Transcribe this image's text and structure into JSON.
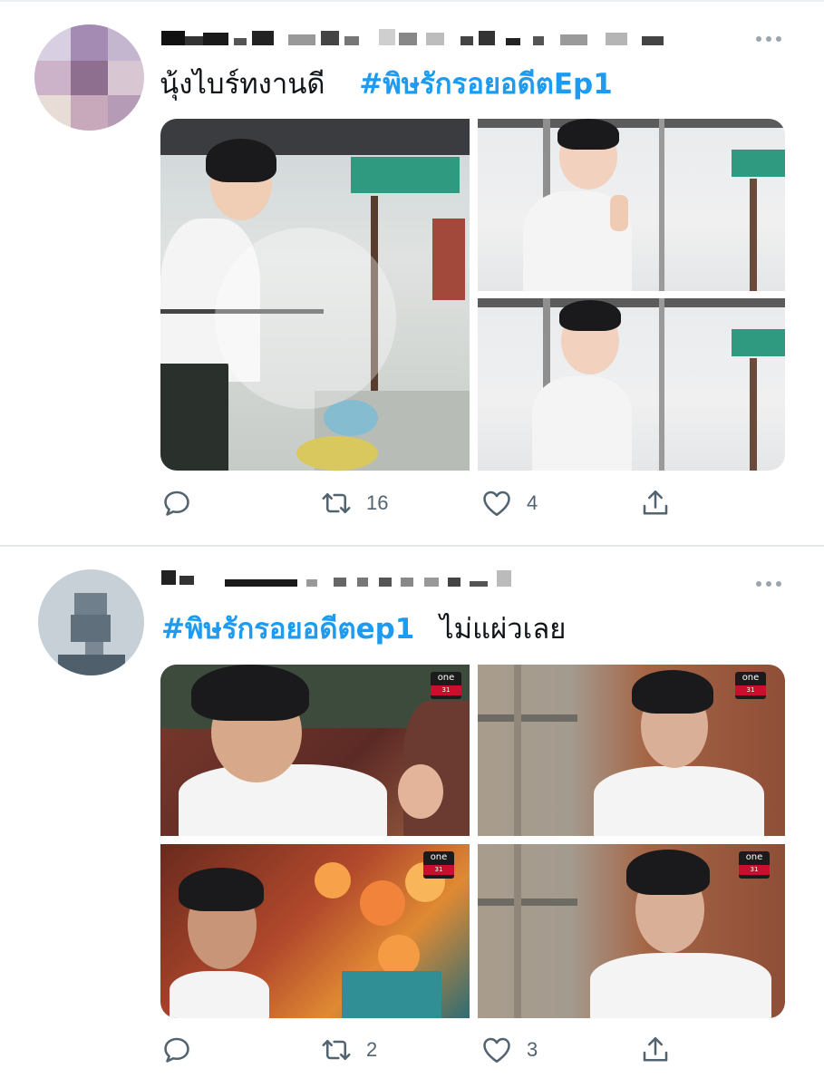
{
  "colors": {
    "accent": "#1d9bf0",
    "text": "#0f1419",
    "secondary": "#536471",
    "divider": "#e3e7ea"
  },
  "tweets": [
    {
      "author_name": "",
      "text": "นุ้งไบร์ทงานดี",
      "hashtag": "#พิษรักรอยอดีตEp1",
      "media_count": 3,
      "actions": {
        "reply_icon": "reply-icon",
        "retweet_icon": "retweet-icon",
        "retweet_count": "16",
        "like_icon": "heart-icon",
        "like_count": "4",
        "share_icon": "share-icon"
      }
    },
    {
      "author_name": "",
      "text": "ไม่แผ่วเลย",
      "hashtag": "#พิษรักรอยอดีตep1",
      "media_count": 4,
      "channel_logo": {
        "line1": "one",
        "line2": "31"
      },
      "actions": {
        "reply_icon": "reply-icon",
        "retweet_icon": "retweet-icon",
        "retweet_count": "2",
        "like_icon": "heart-icon",
        "like_count": "3",
        "share_icon": "share-icon"
      }
    }
  ]
}
